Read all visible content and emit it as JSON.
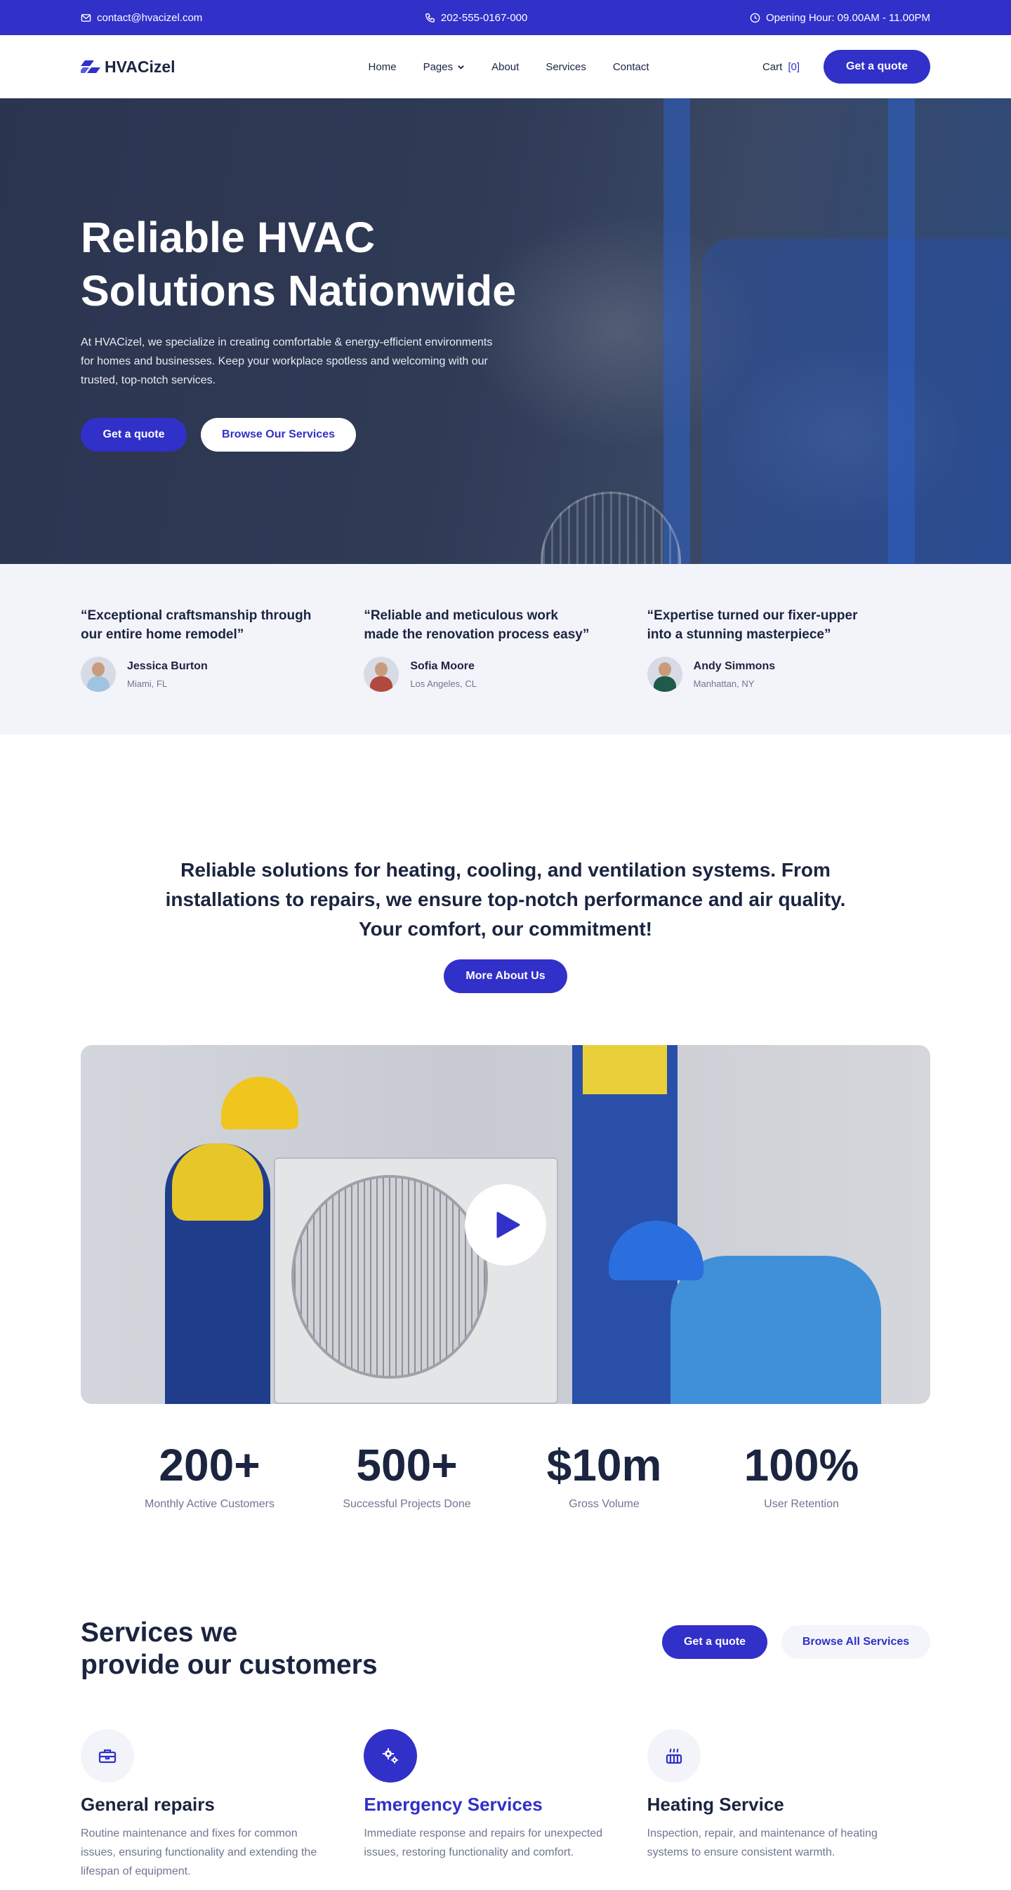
{
  "topbar": {
    "email": "contact@hvacizel.com",
    "phone": "202-555-0167-000",
    "hours": "Opening Hour: 09.00AM - 11.00PM"
  },
  "nav": {
    "logo": "HVACizel",
    "links": [
      "Home",
      "Pages",
      "About",
      "Services",
      "Contact"
    ],
    "cart_label": "Cart",
    "cart_count": "[0]",
    "cta": "Get a quote"
  },
  "hero": {
    "title_line1": "Reliable HVAC",
    "title_line2": "Solutions Nationwide",
    "text": "At HVACizel, we specialize in creating comfortable & energy-efficient environments for homes and businesses. Keep your workplace spotless and welcoming with our trusted, top-notch services.",
    "primary_btn": "Get a quote",
    "secondary_btn": "Browse Our Services"
  },
  "testimonials": [
    {
      "quote": "“Exceptional craftsmanship through our entire home remodel”",
      "name": "Jessica Burton",
      "location": "Miami, FL",
      "shirt": "#9fc4e2"
    },
    {
      "quote": "“Reliable and meticulous work made the renovation process easy”",
      "name": "Sofia Moore",
      "location": "Los Angeles, CL",
      "shirt": "#b14a3e"
    },
    {
      "quote": "“Expertise turned our fixer-upper into a stunning masterpiece”",
      "name": "Andy Simmons",
      "location": "Manhattan, NY",
      "shirt": "#1f5a4b"
    }
  ],
  "about": {
    "heading": "Reliable solutions for heating, cooling, and ventilation systems. From installations to repairs, we ensure top-notch performance and air quality. Your comfort, our commitment!",
    "button": "More About Us"
  },
  "stats": [
    {
      "value": "200+",
      "label": "Monthly Active Customers"
    },
    {
      "value": "500+",
      "label": "Successful Projects Done"
    },
    {
      "value": "$10m",
      "label": "Gross Volume"
    },
    {
      "value": "100%",
      "label": "User Retention"
    }
  ],
  "services": {
    "heading_line1": "Services we",
    "heading_line2": "provide our customers",
    "primary_btn": "Get a quote",
    "secondary_btn": "Browse All Services",
    "items": [
      {
        "title": "General repairs",
        "text": "Routine maintenance and fixes for common issues, ensuring functionality and extending the lifespan of equipment.",
        "icon": "toolbox-icon"
      },
      {
        "title": "Emergency Services",
        "text": "Immediate response and repairs for unexpected issues, restoring functionality and comfort.",
        "icon": "gears-icon"
      },
      {
        "title": "Heating Service",
        "text": "Inspection, repair, and maintenance of heating systems to ensure consistent warmth.",
        "icon": "heater-icon"
      }
    ]
  },
  "colors": {
    "brand": "#3130c9",
    "dark": "#1b2440",
    "muted": "#6f7690",
    "soft_bg": "#f3f4f9"
  }
}
